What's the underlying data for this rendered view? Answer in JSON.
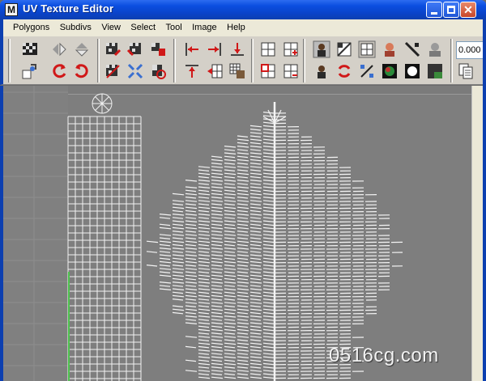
{
  "window": {
    "title": "UV Texture Editor",
    "app_icon": "M"
  },
  "menu": {
    "items": [
      "Polygons",
      "Subdivs",
      "View",
      "Select",
      "Tool",
      "Image",
      "Help"
    ]
  },
  "toolbar": {
    "field_value": "0.000",
    "icons_row1": [
      "checker-icon",
      "flip-u-icon",
      "flip-v-icon",
      "rotate-cw-icon",
      "rotate-ccw-icon",
      "cut-uv-icon",
      "move-left-icon",
      "move-right-icon",
      "move-down-icon",
      "grid-icon",
      "grid-add-icon",
      "isolate-select-icon",
      "uv-shell-icon",
      "texture-borders-icon",
      "dim-image-icon",
      "person-icon",
      "snap-icon"
    ],
    "icons_row2": [
      "lasso-icon",
      "undo-red-icon",
      "redo-red-icon",
      "sew-uv-icon",
      "unfold-icon",
      "relax-icon",
      "move-up-icon",
      "move-left-grid-icon",
      "layout-icon",
      "grid-frame-icon",
      "grid-minus-icon",
      "person-select-icon",
      "cycle-icon",
      "percent-icon",
      "color-icon",
      "circle-icon",
      "ped-icon",
      "copy-icon"
    ]
  },
  "watermark": "0516cg.com",
  "colors": {
    "titlebar": "#0b4ee0",
    "menubar": "#ece9d8",
    "toolbar": "#d4d0c8",
    "viewport": "#7b7b7b",
    "uv_lines": "#ffffff",
    "axis": "#4fc34f"
  }
}
